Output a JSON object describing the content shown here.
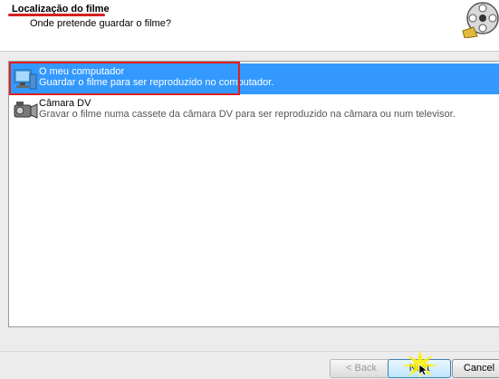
{
  "header": {
    "title": "Localização do filme",
    "subtitle": "Onde pretende guardar o filme?",
    "icon": "film-reel-icon"
  },
  "options": [
    {
      "label": "O meu computador",
      "description": "Guardar o filme para ser reproduzido no computador.",
      "icon": "computer-icon",
      "selected": true
    },
    {
      "label": "Câmara DV",
      "description": "Gravar o filme numa cassete da câmara DV para ser reproduzido na câmara ou num televisor.",
      "icon": "camcorder-icon",
      "selected": false
    }
  ],
  "buttons": {
    "back": "< Back",
    "next": "Next",
    "cancel": "Cancel"
  },
  "colors": {
    "selection": "#3399ff",
    "annotation": "#e02020"
  }
}
